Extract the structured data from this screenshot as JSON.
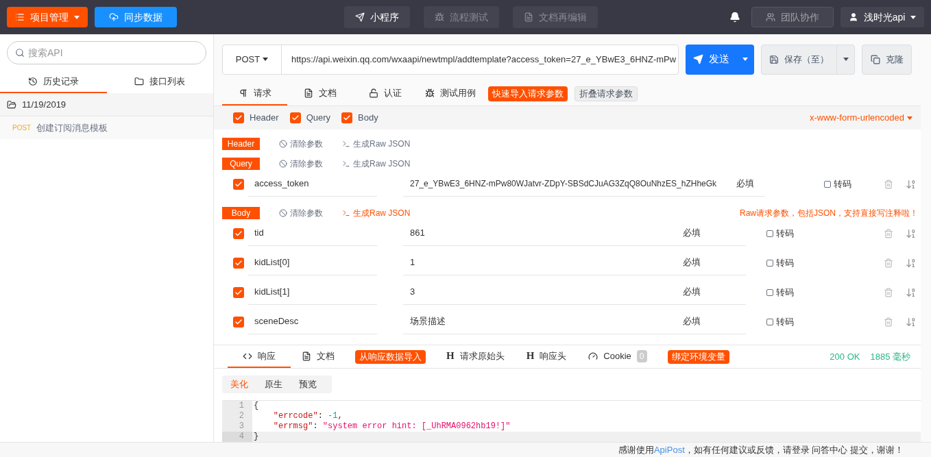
{
  "topbar": {
    "left_buttons": [
      {
        "label": "项目管理",
        "kind": "menu"
      },
      {
        "label": "同步数据",
        "kind": "sync"
      }
    ],
    "center_tabs": [
      {
        "label": "小程序",
        "kind": "send",
        "disabled": false
      },
      {
        "label": "流程测试",
        "kind": "bug",
        "disabled": true
      },
      {
        "label": "文档再编辑",
        "kind": "doc",
        "disabled": true
      }
    ],
    "team": "团队协作",
    "user": "浅时光api"
  },
  "sidebar": {
    "search": {
      "placeholder": "搜索API"
    },
    "tabs": [
      {
        "label": "历史记录",
        "kind": "history",
        "selected": true
      },
      {
        "label": "接口列表",
        "kind": "folder",
        "selected": false
      }
    ],
    "groups": [
      {
        "date": "11/19/2019",
        "items": [
          {
            "method": "POST",
            "name": "创建订阅消息模板"
          }
        ]
      }
    ]
  },
  "request": {
    "method": "POST",
    "url": "https://api.weixin.qq.com/wxaapi/newtmpl/addtemplate?access_token=27_e_YBwE3_6HNZ-mPw",
    "send": "发送",
    "save": "保存（至）",
    "clone": "克隆",
    "tabs": [
      {
        "label": "请求",
        "kind": "pilcrow",
        "selected": true
      },
      {
        "label": "文档",
        "kind": "doc",
        "selected": false
      },
      {
        "label": "认证",
        "kind": "lock",
        "selected": false
      },
      {
        "label": "测试用例",
        "kind": "bug",
        "selected": false
      }
    ],
    "quick_import": "快速导入请求参数",
    "collapse": "折叠请求参数",
    "toggles": [
      {
        "label": "Header",
        "checked": true
      },
      {
        "label": "Query",
        "checked": true
      },
      {
        "label": "Body",
        "checked": true
      }
    ],
    "body_type": "x-www-form-urlencoded",
    "sections": [
      {
        "label": "Header",
        "clear": "清除参数",
        "raw": "生成Raw JSON",
        "raw_active": false
      },
      {
        "label": "Query",
        "clear": "清除参数",
        "raw": "生成Raw JSON",
        "raw_active": false,
        "wide": true,
        "rows": [
          {
            "checked": true,
            "key": "access_token",
            "value": "27_e_YBwE3_6HNZ-mPw80WJatvr-ZDpY-SBSdCJuAG3ZqQ8OuNhzES_hZHheGk",
            "required": "必填",
            "encode": "转码",
            "encode_checked": false
          }
        ]
      },
      {
        "label": "Body",
        "clear": "清除参数",
        "raw": "生成Raw JSON",
        "raw_active": true,
        "wide": false,
        "hint": "Raw请求参数，包括JSON，支持直接写注释啦！",
        "rows": [
          {
            "checked": true,
            "key": "tid",
            "value": "861",
            "required": "必填",
            "encode": "转码",
            "encode_checked": false
          },
          {
            "checked": true,
            "key": "kidList[0]",
            "value": "1",
            "required": "必填",
            "encode": "转码",
            "encode_checked": false
          },
          {
            "checked": true,
            "key": "kidList[1]",
            "value": "3",
            "required": "必填",
            "encode": "转码",
            "encode_checked": false
          },
          {
            "checked": true,
            "key": "sceneDesc",
            "value": "场景描述",
            "required": "必填",
            "encode": "转码",
            "encode_checked": false
          }
        ]
      }
    ]
  },
  "response": {
    "tabs": [
      {
        "label": "响应",
        "kind": "code",
        "selected": true
      },
      {
        "label": "文档",
        "kind": "doc",
        "selected": false
      },
      {
        "label": "从响应数据导入",
        "kind": "badge",
        "selected": false
      },
      {
        "label": "请求原始头",
        "kind": "h",
        "icon": "H",
        "selected": false
      },
      {
        "label": "响应头",
        "kind": "h",
        "icon": "H",
        "selected": false
      },
      {
        "label": "Cookie",
        "kind": "cookie",
        "count": "0",
        "selected": false
      },
      {
        "label": "绑定环境变量",
        "kind": "badge",
        "selected": false
      }
    ],
    "status": "200 OK",
    "time": "1885 毫秒",
    "views": [
      {
        "label": "美化",
        "selected": true
      },
      {
        "label": "原生",
        "selected": false
      },
      {
        "label": "预览",
        "selected": false
      }
    ],
    "code": [
      {
        "number": "1",
        "active": false,
        "tokens": [
          {
            "kind": "punct",
            "text": "{"
          }
        ]
      },
      {
        "number": "2",
        "active": false,
        "tokens": [
          {
            "kind": "key",
            "text": "\"errcode\""
          },
          {
            "kind": "punct",
            "text": ": "
          },
          {
            "kind": "number",
            "text": "-1"
          },
          {
            "kind": "punct",
            "text": ","
          }
        ]
      },
      {
        "number": "3",
        "active": false,
        "tokens": [
          {
            "kind": "key",
            "text": "\"errmsg\""
          },
          {
            "kind": "punct",
            "text": ": "
          },
          {
            "kind": "string",
            "text": "\"system error hint: [_UhRMA0962hb19!]\""
          }
        ]
      },
      {
        "number": "4",
        "active": true,
        "tokens": [
          {
            "kind": "punct",
            "text": "}"
          }
        ]
      }
    ]
  },
  "footer": {
    "before": "感谢使用",
    "link": "ApiPost",
    "after": "，如有任何建议或反馈，请登录 问答中心 提交，谢谢！"
  }
}
